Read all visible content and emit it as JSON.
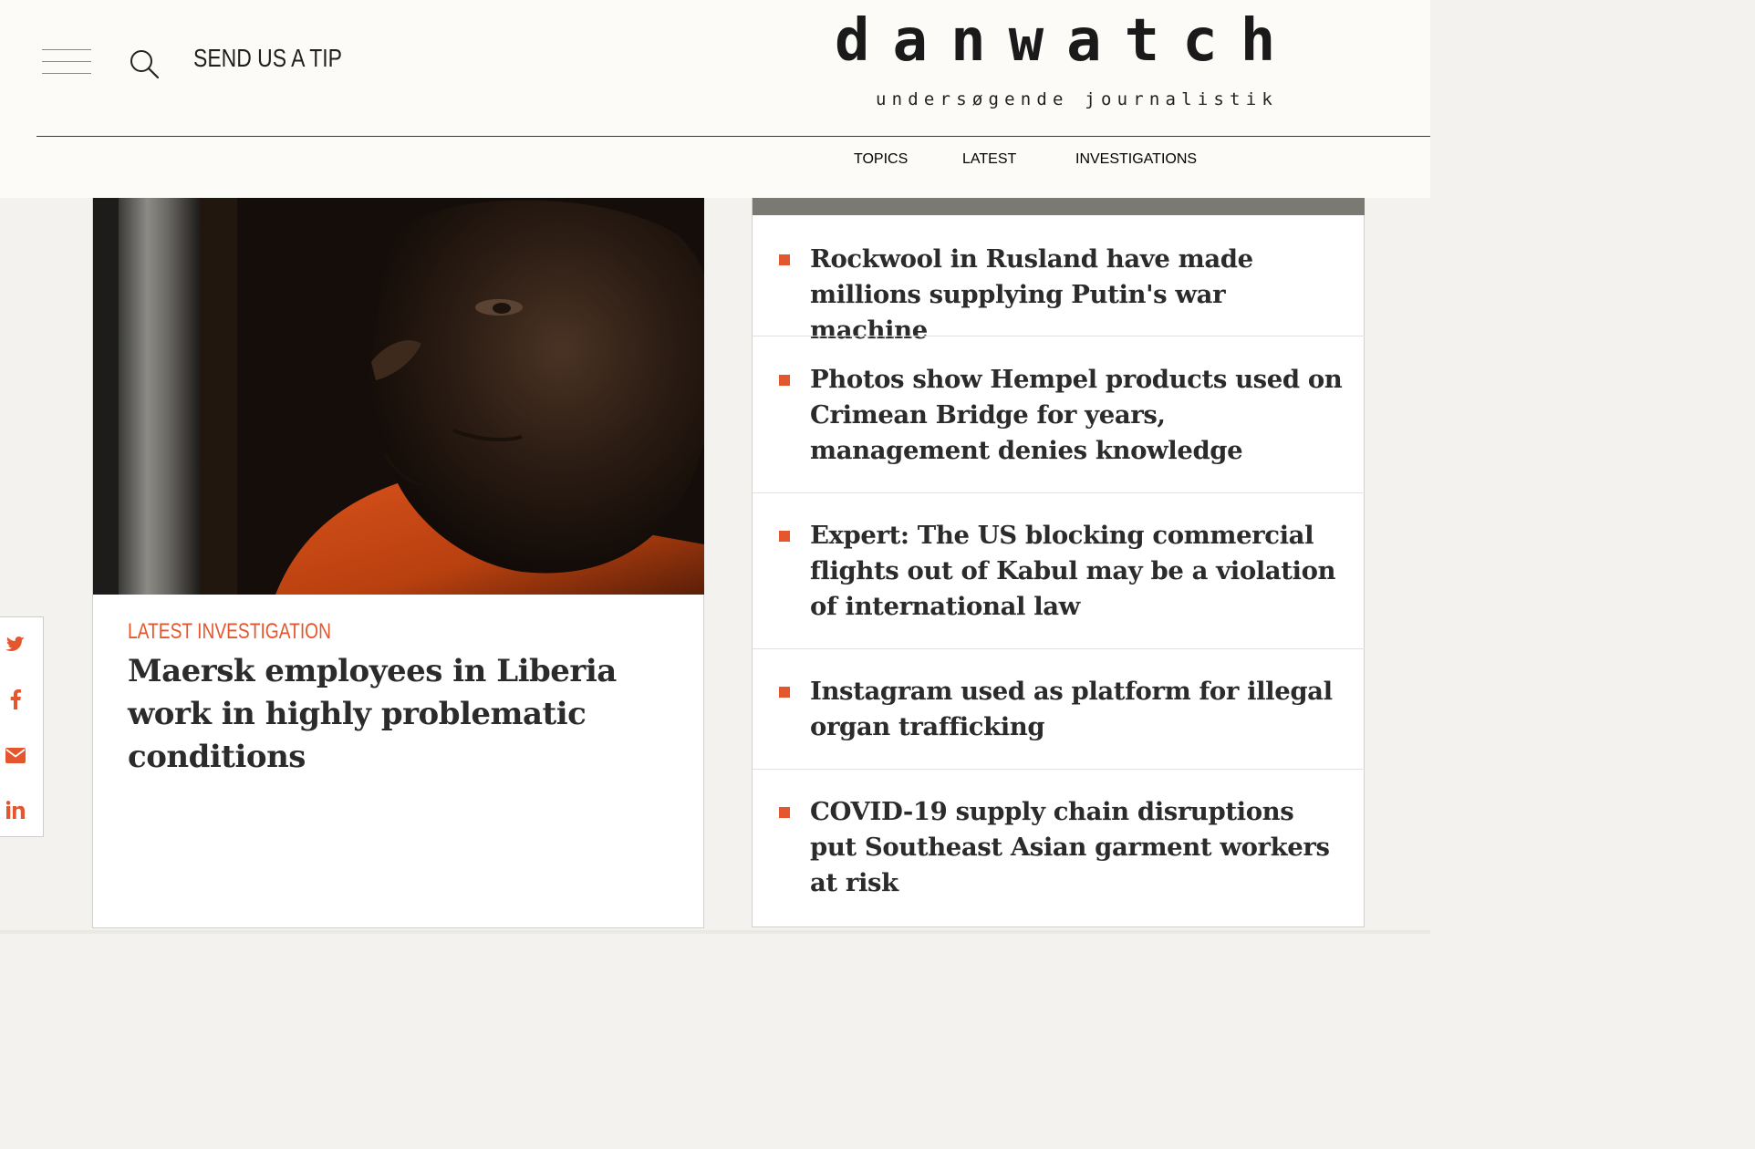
{
  "header": {
    "tip_label": "SEND US A TIP",
    "logo": "danwatch",
    "tagline": "undersøgende journalistik",
    "nav": {
      "topics": "TOPICS",
      "latest": "LATEST",
      "investigations": "INVESTIGATIONS"
    }
  },
  "feature": {
    "kicker": "LATEST INVESTIGATION",
    "title": "Maersk employees in Liberia work in highly problematic conditions"
  },
  "headlines": [
    {
      "text": "Rockwool in Rusland have made millions supplying Putin's war machine"
    },
    {
      "text": "Photos show Hempel products used on Crimean Bridge for years, management denies knowledge"
    },
    {
      "text": "Expert: The US blocking commercial flights out of Kabul may be a violation of international law"
    },
    {
      "text": "Instagram used as platform for illegal organ trafficking"
    },
    {
      "text": "COVID-19 supply chain disruptions put Southeast Asian garment workers at risk"
    }
  ],
  "share": {
    "icons": [
      "twitter-icon",
      "facebook-icon",
      "email-icon",
      "linkedin-icon"
    ]
  },
  "colors": {
    "accent": "#e4572e",
    "header_bg": "#fcfbf8",
    "page_bg": "#f4f2ee",
    "text": "#2b2b2b",
    "list_topbar": "#7b7a72"
  }
}
